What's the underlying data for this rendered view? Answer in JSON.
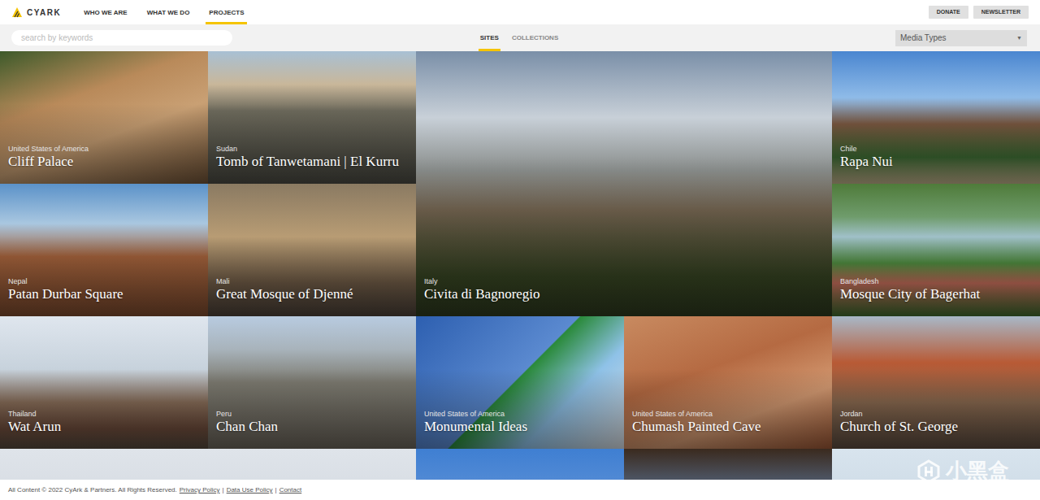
{
  "header": {
    "logo": "CYARK",
    "nav": [
      {
        "label": "WHO WE ARE",
        "selected": false
      },
      {
        "label": "WHAT WE DO",
        "selected": false
      },
      {
        "label": "PROJECTS",
        "selected": true
      }
    ],
    "buttons": [
      "DONATE",
      "NEWSLETTER"
    ]
  },
  "toolbar": {
    "search": {
      "placeholder": "search by keywords"
    },
    "tabs": [
      {
        "label": "SITES",
        "selected": true
      },
      {
        "label": "COLLECTIONS",
        "selected": false
      }
    ],
    "dropdown": {
      "value": "Media Types",
      "arrow": "▼"
    }
  },
  "sites": [
    {
      "country": "United States of America",
      "name": "Cliff Palace",
      "kind": "normal"
    },
    {
      "country": "Sudan",
      "name": "Tomb of Tanwetamani | El Kurru",
      "kind": "normal"
    },
    {
      "country": "Italy",
      "name": "Civita di Bagnoregio",
      "kind": "large"
    },
    {
      "country": "Chile",
      "name": "Rapa Nui",
      "kind": "normal"
    },
    {
      "country": "Nepal",
      "name": "Patan Durbar Square",
      "kind": "normal"
    },
    {
      "country": "Mali",
      "name": "Great Mosque of Djenné",
      "kind": "normal"
    },
    {
      "country": "Bangladesh",
      "name": "Mosque City of Bagerhat",
      "kind": "normal"
    },
    {
      "country": "Thailand",
      "name": "Wat Arun",
      "kind": "normal"
    },
    {
      "country": "Peru",
      "name": "Chan Chan",
      "kind": "normal"
    },
    {
      "country": "United States of America",
      "name": "Monumental Ideas",
      "kind": "normal"
    },
    {
      "country": "United States of America",
      "name": "Chumash Painted Cave",
      "kind": "normal"
    },
    {
      "country": "Jordan",
      "name": "Church of St. George",
      "kind": "normal"
    }
  ],
  "footer": {
    "copyright": "All Content © 2022 CyArk & Partners. All Rights Reserved.",
    "separator": "|",
    "links": [
      "Privacy Policy",
      "Data Use Policy",
      "Contact"
    ]
  },
  "watermark": "小黑盒"
}
